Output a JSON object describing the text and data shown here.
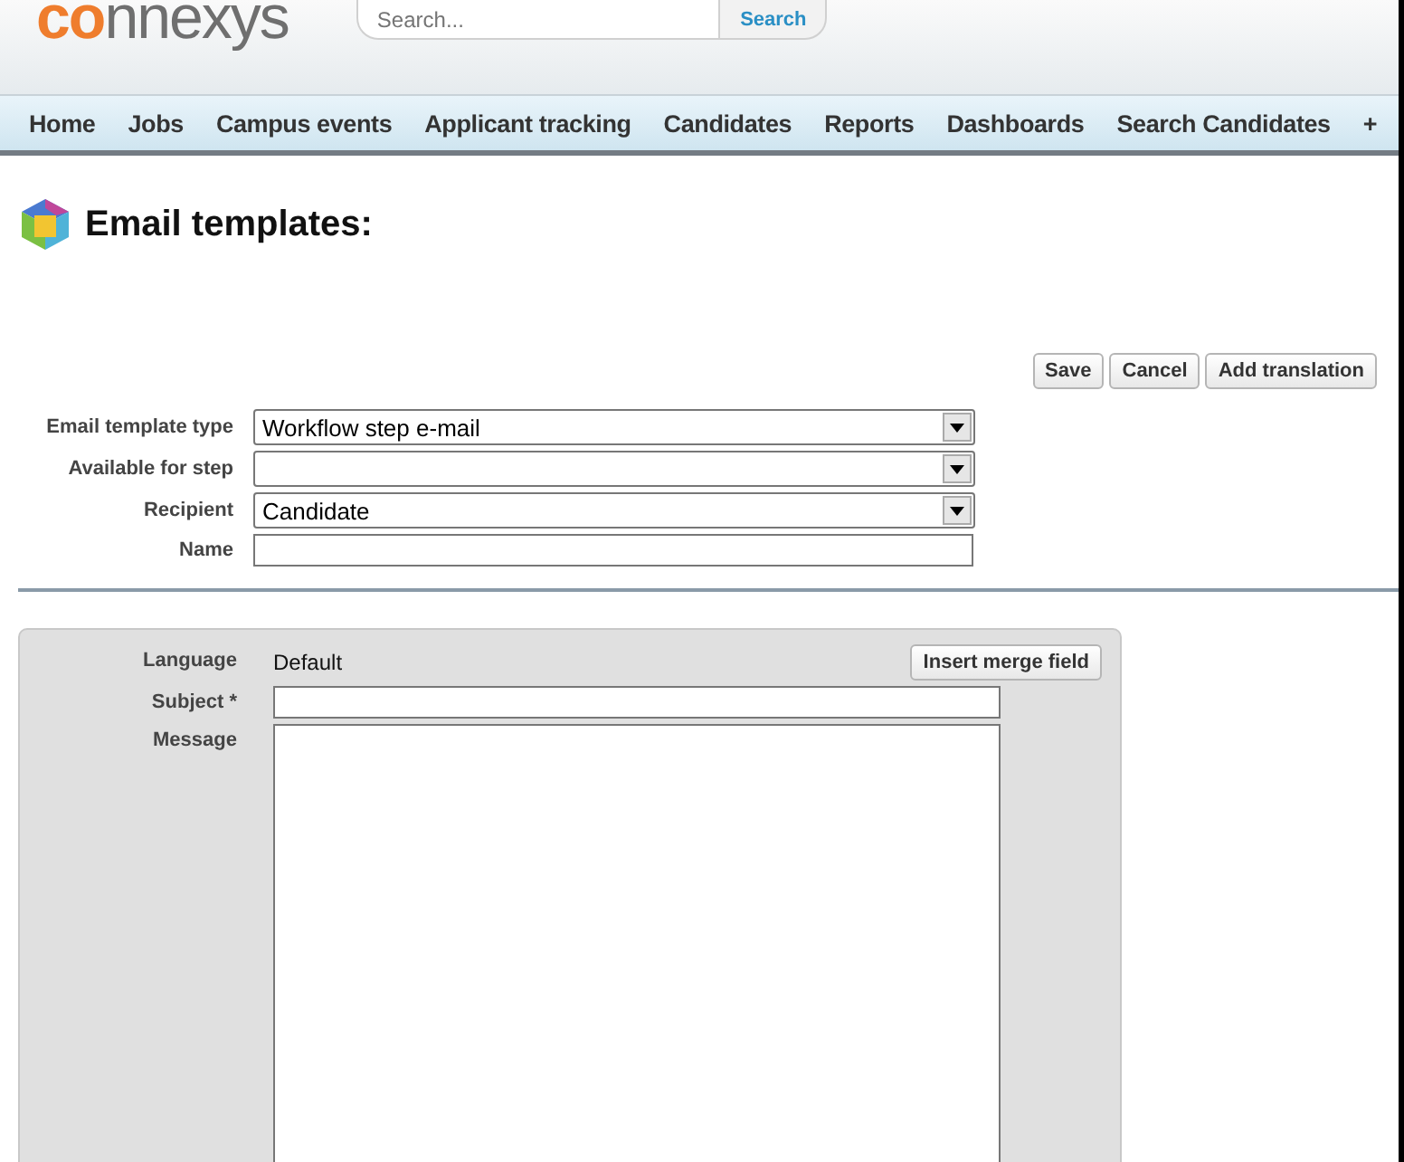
{
  "header": {
    "logo": {
      "accent": "co",
      "rest": "nnexys"
    },
    "search": {
      "placeholder": "Search...",
      "button": "Search"
    }
  },
  "nav": [
    {
      "label": "Home"
    },
    {
      "label": "Jobs"
    },
    {
      "label": "Campus events"
    },
    {
      "label": "Applicant tracking"
    },
    {
      "label": "Candidates"
    },
    {
      "label": "Reports"
    },
    {
      "label": "Dashboards"
    },
    {
      "label": "Search Candidates"
    },
    {
      "label": "+"
    }
  ],
  "page": {
    "title": "Email templates:"
  },
  "actions": [
    "Save",
    "Cancel",
    "Add translation"
  ],
  "form": [
    {
      "label": "Email template type",
      "kind": "select",
      "value": "Workflow step e-mail"
    },
    {
      "label": "Available for step",
      "kind": "select"
    },
    {
      "label": "Recipient",
      "kind": "select",
      "value": "Candidate"
    },
    {
      "label": "Name",
      "kind": "text"
    }
  ],
  "translation": {
    "language_label": "Language",
    "language": "Default",
    "merge_button": "Insert merge field",
    "subject_label": "Subject *",
    "message_label": "Message"
  }
}
